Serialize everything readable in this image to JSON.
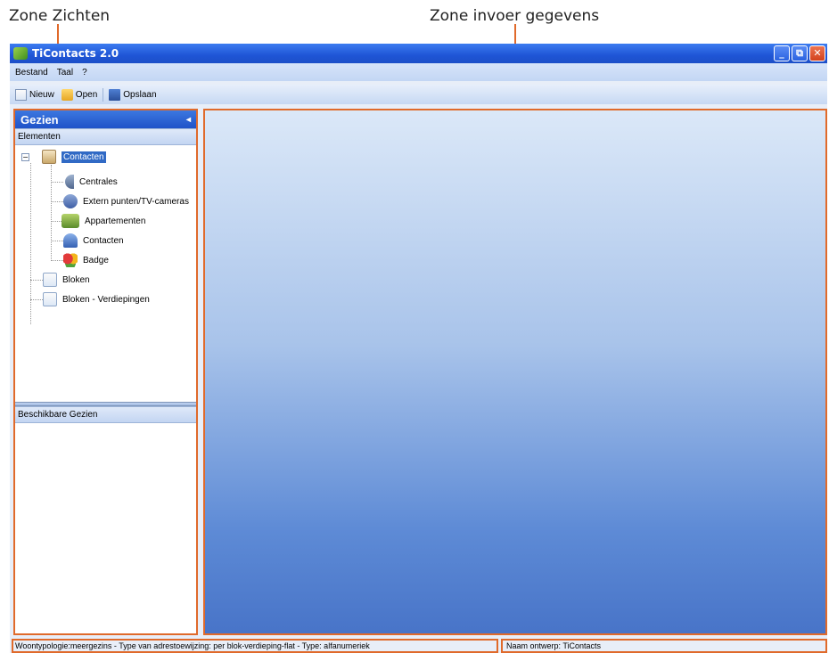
{
  "annotations": {
    "views_zone": "Zone Zichten",
    "data_entry_zone": "Zone invoer gegevens",
    "line_color": "#e06a2b"
  },
  "window": {
    "title": "TiContacts 2.0",
    "app_icon": "ticontacts-leaf-icon",
    "controls": {
      "minimize": "_",
      "restore": "⧉",
      "close": "✕"
    }
  },
  "menu": {
    "items": [
      "Bestand",
      "Taal",
      "?"
    ]
  },
  "toolbar": {
    "new_label": "Nieuw",
    "open_label": "Open",
    "save_label": "Opslaan"
  },
  "sidebar": {
    "title": "Gezien",
    "pin_icon": "pin-icon",
    "elements_header": "Elementen",
    "tree": {
      "root_label": "Contacten",
      "children": [
        {
          "label": "Centrales",
          "icon": "centrale-icon"
        },
        {
          "label": "Extern punten/TV-cameras",
          "icon": "camera-icon"
        },
        {
          "label": "Appartementen",
          "icon": "apartment-icon"
        },
        {
          "label": "Contacten",
          "icon": "person-icon"
        },
        {
          "label": "Badge",
          "icon": "badge-icon"
        }
      ],
      "siblings": [
        {
          "label": "Bloken",
          "icon": "block-icon"
        },
        {
          "label": "Bloken - Verdiepingen",
          "icon": "block-floors-icon"
        }
      ]
    },
    "available_views_header": "Beschikbare Gezien"
  },
  "statusbar": {
    "left_text": "Woontypologie:meergezins - Type van adrestoewijzing: per blok-verdieping-flat - Type: alfanumeriek",
    "right_text": "Naam ontwerp: TiContacts"
  },
  "colors": {
    "accent_outline": "#e06a2b",
    "titlebar": "#1f55d6",
    "selection": "#316ac5"
  }
}
